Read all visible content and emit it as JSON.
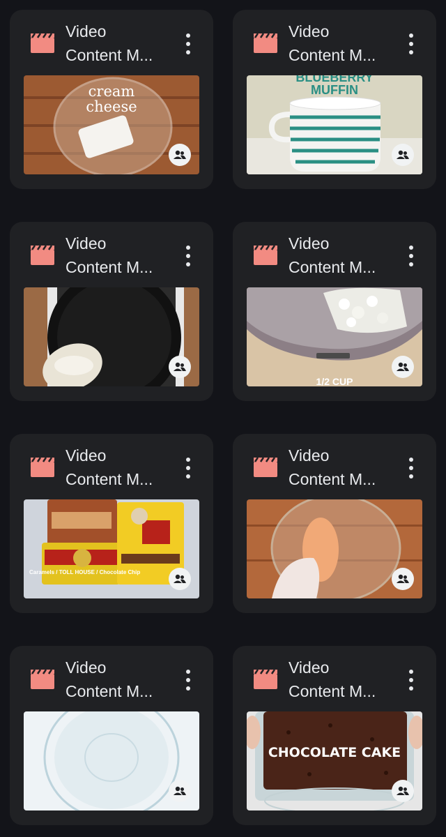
{
  "colors": {
    "background": "#131419",
    "card": "#202124",
    "text": "#e8eaed",
    "accent_icon": "#f28b82"
  },
  "icons": {
    "type": "video-clapper-icon",
    "menu": "more-vert-icon",
    "shared": "shared-people-icon"
  },
  "cards": [
    {
      "title_line1": "Video",
      "title_line2": "Content M...",
      "thumb_caption": "cream\ncheese"
    },
    {
      "title_line1": "Video",
      "title_line2": "Content M...",
      "thumb_caption": "BLUEBERRY\nMUFFIN"
    },
    {
      "title_line1": "Video",
      "title_line2": "Content M...",
      "thumb_caption": ""
    },
    {
      "title_line1": "Video",
      "title_line2": "Content M...",
      "thumb_caption": "1/2 CUP"
    },
    {
      "title_line1": "Video",
      "title_line2": "Content M...",
      "thumb_caption": "Caramels / TOLL HOUSE / Chocolate Chip"
    },
    {
      "title_line1": "Video",
      "title_line2": "Content M...",
      "thumb_caption": ""
    },
    {
      "title_line1": "Video",
      "title_line2": "Content M...",
      "thumb_caption": ""
    },
    {
      "title_line1": "Video",
      "title_line2": "Content M...",
      "thumb_caption": "CHOCOLATE CAKE"
    }
  ]
}
